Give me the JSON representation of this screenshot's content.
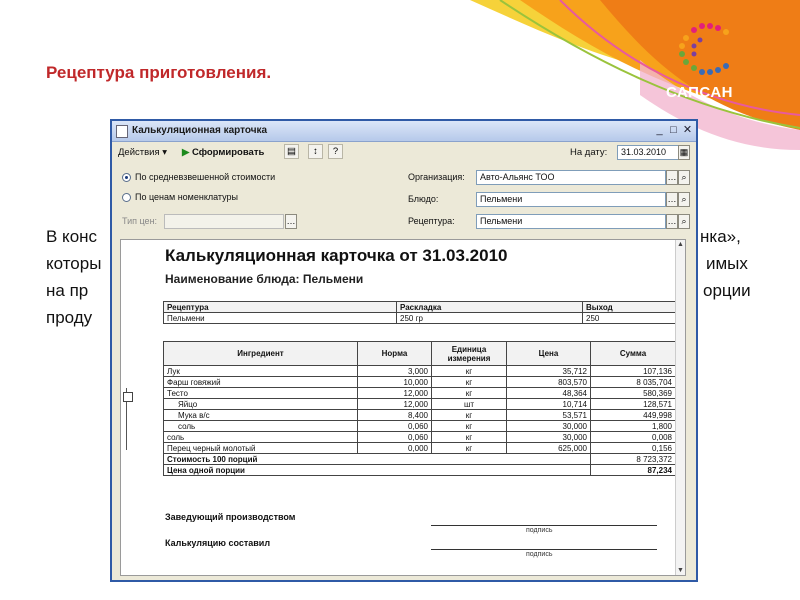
{
  "slide": {
    "title": "Рецептура приготовления.",
    "body_lines": [
      "В конс",
      "которы",
      "на пр",
      "проду"
    ],
    "body_right": [
      "нка»,",
      "имых",
      "орции"
    ],
    "logo_text": "САПСАН"
  },
  "window": {
    "title": "Калькуляционная карточка",
    "controls": {
      "minimize": "_",
      "maximize": "□",
      "close": "✕"
    }
  },
  "toolbar": {
    "actions_label": "Действия",
    "form_label": "Сформировать",
    "help_label": "?",
    "date_label": "На дату:",
    "date_value": "31.03.2010"
  },
  "form": {
    "radio_avg": "По средневзвешенной стоимости",
    "radio_price": "По ценам номенклатуры",
    "price_type_label": "Тип цен:",
    "price_type_value": "",
    "org_label": "Организация:",
    "org_value": "Авто-Альянс ТОО",
    "dish_label": "Блюдо:",
    "dish_value": "Пельмени",
    "recipe_label": "Рецептура:",
    "recipe_value": "Пельмени"
  },
  "report": {
    "title": "Калькуляционная карточка от 31.03.2010",
    "dish_line": "Наименование блюда:  Пельмени",
    "top_table": {
      "headers": [
        "Рецептура",
        "Раскладка",
        "Выход"
      ],
      "row": [
        "Пельмени",
        "250 гр",
        "250"
      ]
    },
    "headers": {
      "ingredient": "Ингредиент",
      "norm": "Норма",
      "unit": "Единица измерения",
      "price": "Цена",
      "sum": "Сумма"
    },
    "rows": [
      {
        "name": "Лук",
        "norm": "3,000",
        "unit": "кг",
        "price": "35,712",
        "sum": "107,136",
        "indent": false
      },
      {
        "name": "Фарш говяжий",
        "norm": "10,000",
        "unit": "кг",
        "price": "803,570",
        "sum": "8 035,704",
        "indent": false
      },
      {
        "name": "Тесто",
        "norm": "12,000",
        "unit": "кг",
        "price": "48,364",
        "sum": "580,369",
        "indent": false
      },
      {
        "name": "Яйцо",
        "norm": "12,000",
        "unit": "шт",
        "price": "10,714",
        "sum": "128,571",
        "indent": true
      },
      {
        "name": "Мука в/с",
        "norm": "8,400",
        "unit": "кг",
        "price": "53,571",
        "sum": "449,998",
        "indent": true
      },
      {
        "name": "соль",
        "norm": "0,060",
        "unit": "кг",
        "price": "30,000",
        "sum": "1,800",
        "indent": true
      },
      {
        "name": "соль",
        "norm": "0,060",
        "unit": "кг",
        "price": "30,000",
        "sum": "0,008",
        "indent": false
      },
      {
        "name": "Перец черный молотый",
        "norm": "0,000",
        "unit": "кг",
        "price": "625,000",
        "sum": "0,156",
        "indent": false
      }
    ],
    "total_100_label": "Стоимость 100 порций",
    "total_100_value": "8 723,372",
    "portion_label": "Цена одной порции",
    "portion_value": "87,234",
    "sign_head": "Заведующий производством",
    "sign_made": "Калькуляцию составил",
    "sign_caption": "подпись"
  },
  "colors": {
    "title_red": "#c0282a",
    "window_border": "#2f5aa6"
  }
}
